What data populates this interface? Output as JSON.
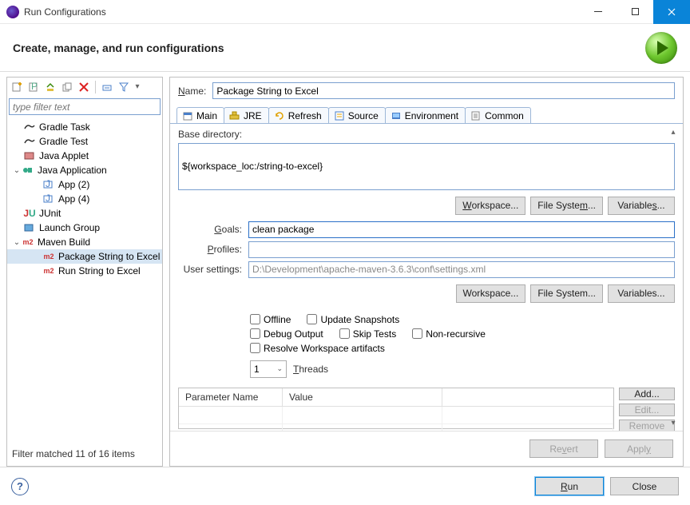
{
  "window": {
    "title": "Run Configurations"
  },
  "header": {
    "headline": "Create, manage, and run configurations"
  },
  "left": {
    "filter_placeholder": "type filter text",
    "items": [
      {
        "label": "Gradle Task"
      },
      {
        "label": "Gradle Test"
      },
      {
        "label": "Java Applet"
      },
      {
        "label": "Java Application"
      },
      {
        "label": "App (2)"
      },
      {
        "label": "App (4)"
      },
      {
        "label": "JUnit"
      },
      {
        "label": "Launch Group"
      },
      {
        "label": "Maven Build"
      },
      {
        "label": "Package String to Excel"
      },
      {
        "label": "Run String to Excel"
      }
    ],
    "status": "Filter matched 11 of 16 items"
  },
  "form": {
    "name_label": "Name:",
    "name_value": "Package String to Excel",
    "tabs": [
      "Main",
      "JRE",
      "Refresh",
      "Source",
      "Environment",
      "Common"
    ],
    "base_dir_label": "Base directory:",
    "base_dir_value": "${workspace_loc:/string-to-excel}",
    "goals_label": "Goals:",
    "goals_value": "clean package",
    "profiles_label": "Profiles:",
    "profiles_value": "",
    "user_settings_label": "User settings:",
    "user_settings_value": "D:\\Development\\apache-maven-3.6.3\\conf\\settings.xml",
    "btn_workspace": "Workspace...",
    "btn_filesystem": "File System...",
    "btn_variables": "Variables...",
    "checks": {
      "offline": "Offline",
      "update_snapshots": "Update Snapshots",
      "debug_output": "Debug Output",
      "skip_tests": "Skip Tests",
      "non_recursive": "Non-recursive",
      "resolve_ws": "Resolve Workspace artifacts"
    },
    "threads_value": "1",
    "threads_label": "Threads",
    "table": {
      "col1": "Parameter Name",
      "col2": "Value"
    },
    "btn_add": "Add...",
    "btn_edit": "Edit...",
    "btn_remove": "Remove",
    "btn_revert": "Revert",
    "btn_apply": "Apply"
  },
  "dialog": {
    "btn_run": "Run",
    "btn_close": "Close"
  }
}
